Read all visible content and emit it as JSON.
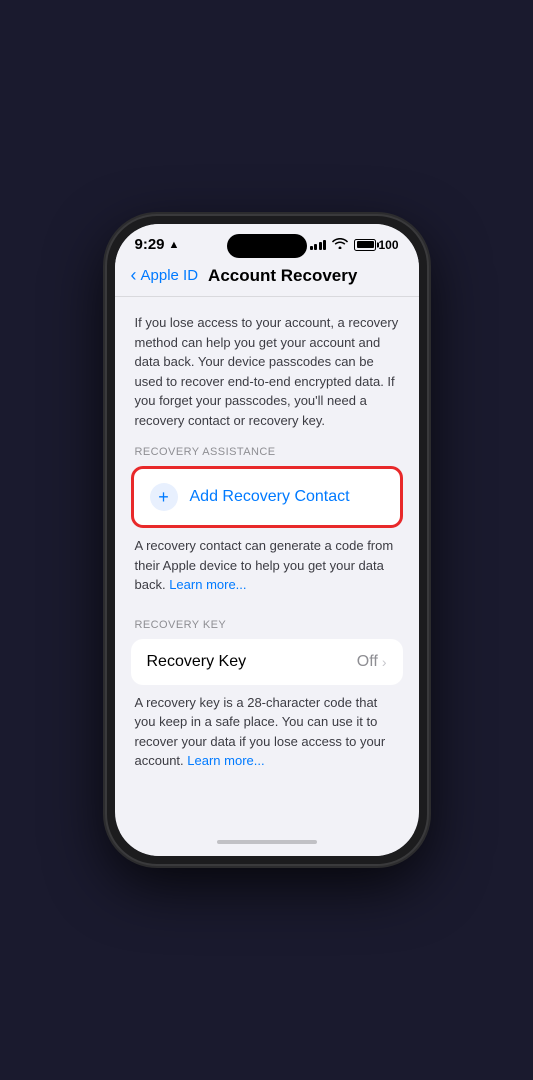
{
  "status_bar": {
    "time": "9:29",
    "battery_level": "100",
    "location_icon": "▲"
  },
  "nav": {
    "back_label": "Apple ID",
    "title": "Account Recovery"
  },
  "description": {
    "text": "If you lose access to your account, a recovery method can help you get your account and data back. Your device passcodes can be used to recover end-to-end encrypted data. If you forget your passcodes, you'll need a recovery contact or recovery key."
  },
  "recovery_assistance": {
    "section_label": "RECOVERY ASSISTANCE",
    "add_contact_label": "Add Recovery Contact",
    "add_icon": "+",
    "caption": "A recovery contact can generate a code from their Apple device to help you get your data back.",
    "learn_more": "Learn more..."
  },
  "recovery_key": {
    "section_label": "RECOVERY KEY",
    "row_label": "Recovery Key",
    "row_value": "Off",
    "caption_part1": "A recovery key is a 28-character code that you keep in a safe place. You can use it to recover your data if you lose access to your account.",
    "learn_more": "Learn more..."
  },
  "home_indicator": {
    "visible": true
  }
}
